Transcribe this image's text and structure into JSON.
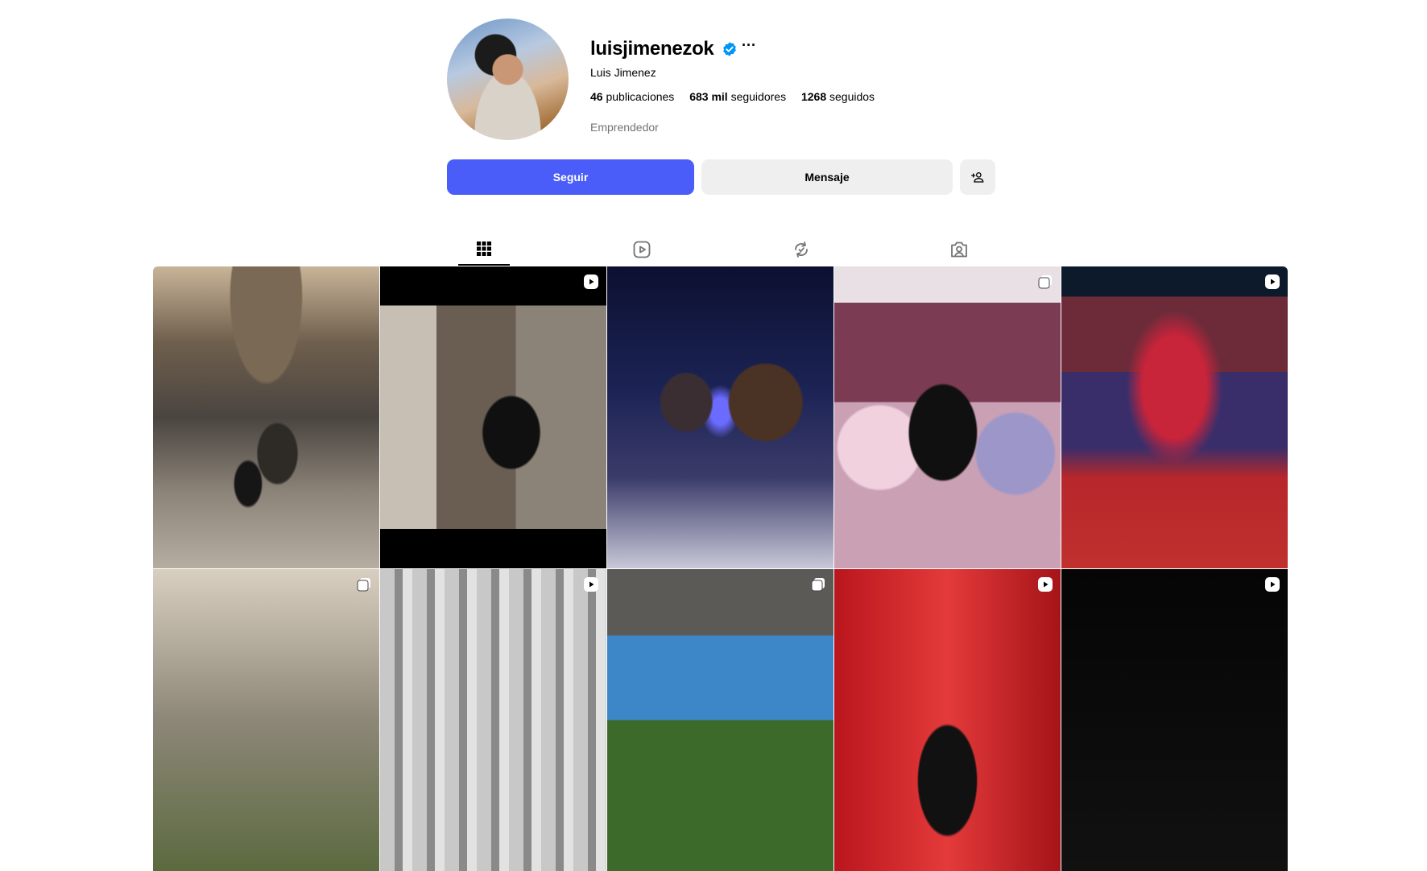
{
  "profile": {
    "username": "luisjimenezok",
    "verified_icon": "verified-badge-icon",
    "more_label": "···",
    "full_name": "Luis Jimenez",
    "category": "Emprendedor",
    "stats": [
      {
        "count": "46",
        "label": "publicaciones"
      },
      {
        "count": "683 mil",
        "label": "seguidores"
      },
      {
        "count": "1268",
        "label": "seguidos"
      }
    ]
  },
  "actions": {
    "follow_label": "Seguir",
    "message_label": "Mensaje",
    "suggest_icon": "person-add-icon"
  },
  "tabs": [
    {
      "name": "posts",
      "icon": "grid-icon",
      "active": true
    },
    {
      "name": "reels",
      "icon": "reels-icon",
      "active": false
    },
    {
      "name": "reposts",
      "icon": "repost-icon",
      "active": false
    },
    {
      "name": "tagged",
      "icon": "tagged-icon",
      "active": false
    }
  ],
  "posts": [
    {
      "badge": "none"
    },
    {
      "badge": "reel"
    },
    {
      "badge": "none"
    },
    {
      "badge": "carousel"
    },
    {
      "badge": "reel"
    },
    {
      "badge": "carousel"
    },
    {
      "badge": "reel"
    },
    {
      "badge": "carousel"
    },
    {
      "badge": "reel"
    },
    {
      "badge": "reel"
    }
  ],
  "colors": {
    "primary_button": "#4a5df9",
    "secondary_button": "#efefef",
    "verified": "#0095f6",
    "muted_text": "#737373"
  }
}
